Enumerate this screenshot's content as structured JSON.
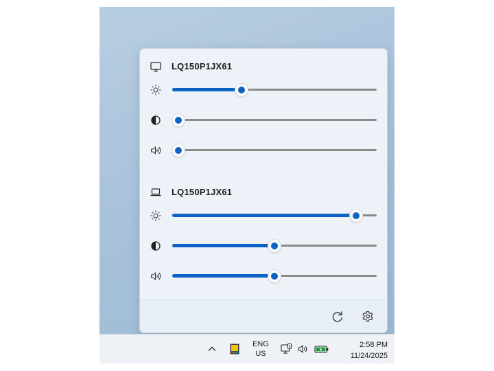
{
  "flyout": {
    "monitors": [
      {
        "name": "LQ150P1JX61",
        "device_icon": "monitor-icon",
        "controls": [
          {
            "kind": "brightness",
            "icon": "brightness-icon",
            "value": 0.34
          },
          {
            "kind": "contrast",
            "icon": "contrast-icon",
            "value": 0.03
          },
          {
            "kind": "volume",
            "icon": "volume-icon",
            "value": 0.03
          }
        ]
      },
      {
        "name": "LQ150P1JX61",
        "device_icon": "laptop-icon",
        "controls": [
          {
            "kind": "brightness",
            "icon": "brightness-icon",
            "value": 0.9
          },
          {
            "kind": "contrast",
            "icon": "contrast-icon",
            "value": 0.5
          },
          {
            "kind": "volume",
            "icon": "volume-icon",
            "value": 0.5
          }
        ]
      }
    ],
    "footer": {
      "refresh_icon": "refresh-icon",
      "settings_icon": "gear-icon"
    }
  },
  "taskbar": {
    "overflow_icon": "chevron-up-icon",
    "tray_app_icon": "app-tray-icon",
    "language": {
      "line1": "ENG",
      "line2": "US"
    },
    "system_icons": [
      "network-monitor-icon",
      "speaker-icon",
      "battery-charging-icon"
    ],
    "clock": {
      "time": "2:58 PM",
      "date": "11/24/2025"
    }
  },
  "colors": {
    "accent": "#0d63c4",
    "track": "#8a8a8a",
    "flyout_bg": "#edf2f8",
    "taskbar_bg": "#eef2f7"
  }
}
